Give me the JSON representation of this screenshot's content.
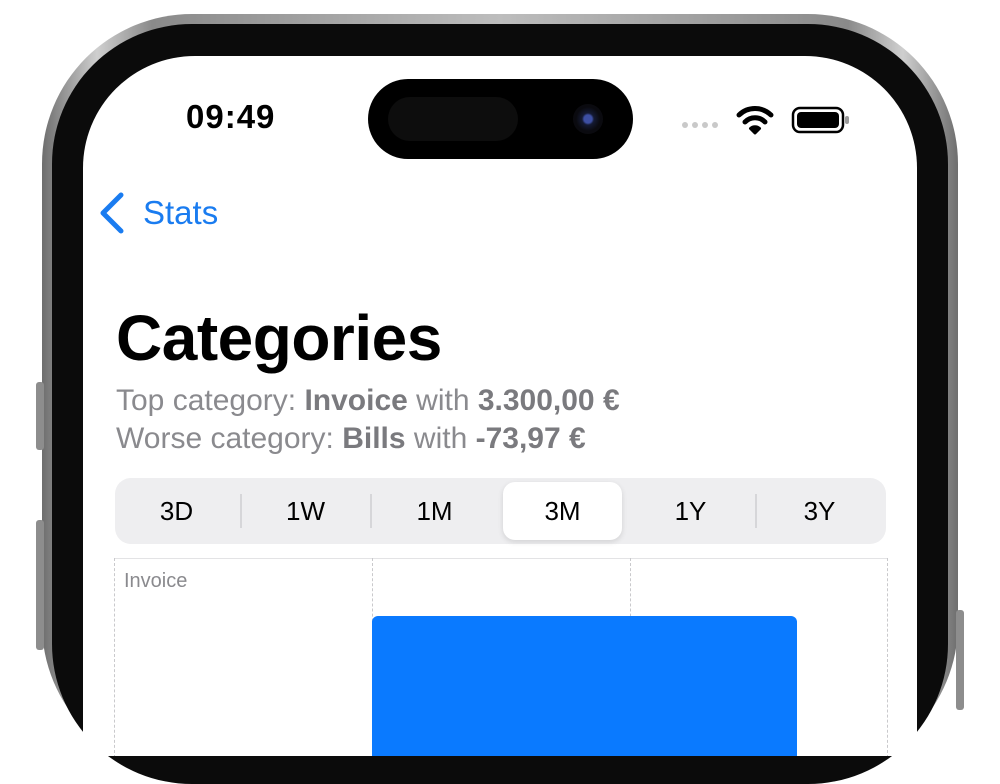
{
  "status_bar": {
    "time": "09:49",
    "icons": [
      "signal-dots-icon",
      "wifi-icon",
      "battery-icon"
    ]
  },
  "nav": {
    "back_label": "Stats",
    "back_icon": "chevron-left-icon"
  },
  "page": {
    "title": "Categories",
    "top_category": {
      "prefix": "Top category: ",
      "name": "Invoice",
      "middle": " with ",
      "amount": "3.300,00 €"
    },
    "worse_category": {
      "prefix": "Worse category: ",
      "name": "Bills",
      "middle": " with ",
      "amount": "-73,97 €"
    }
  },
  "segmented_control": {
    "options": [
      "3D",
      "1W",
      "1M",
      "3M",
      "1Y",
      "3Y"
    ],
    "selected": "3M"
  },
  "chart_data": {
    "type": "bar",
    "orientation": "horizontal",
    "categories": [
      "Invoice"
    ],
    "values": [
      3300
    ],
    "grid": true
  },
  "colors": {
    "accent": "#1a7cf0",
    "bar": "#0a7aff",
    "secondary_text": "#8a8a8e"
  }
}
